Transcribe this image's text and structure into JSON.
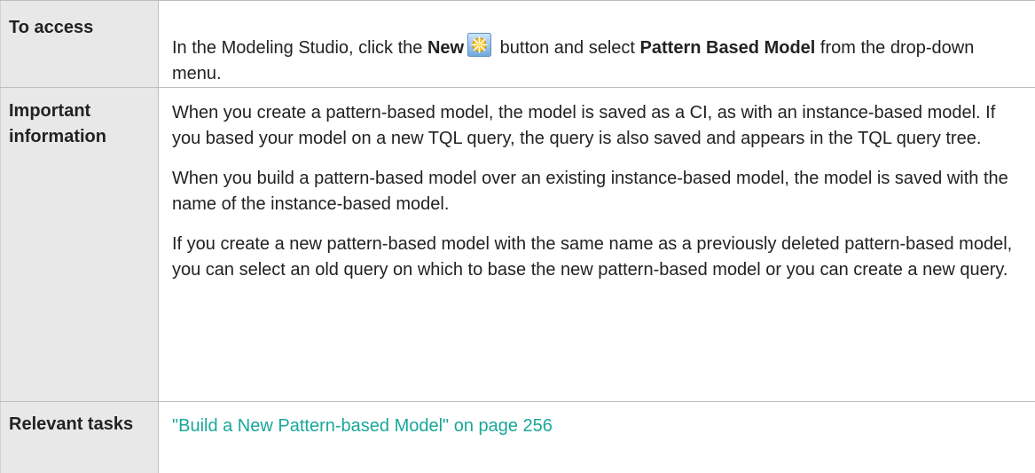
{
  "rows": [
    {
      "label": "To access",
      "text": {
        "prefix": "In the Modeling Studio, click the ",
        "new_label": "New",
        "middle": " button and select ",
        "model_label": "Pattern Based Model",
        "suffix": " from the drop-down menu."
      }
    },
    {
      "label": "Important information",
      "paragraphs": [
        "When you create a pattern-based model, the model is saved as a CI, as with an instance-based model. If you based your model on a new TQL query, the query is also saved and appears in the TQL query tree.",
        "When you build a pattern-based model over an existing instance-based model, the model is saved with the name of the instance-based model.",
        "If you create a new pattern-based model with the same name as a previously deleted pattern-based model, you can select an old query on which to base the new pattern-based model or you can create a new query."
      ]
    },
    {
      "label": "Relevant tasks",
      "link": "\"Build a New Pattern-based Model\" on page 256"
    }
  ],
  "icons": {
    "new": "new-model-icon"
  },
  "colors": {
    "label_background": "#e8e8e8",
    "link": "#1aa79a",
    "border": "#bdbdbd"
  }
}
